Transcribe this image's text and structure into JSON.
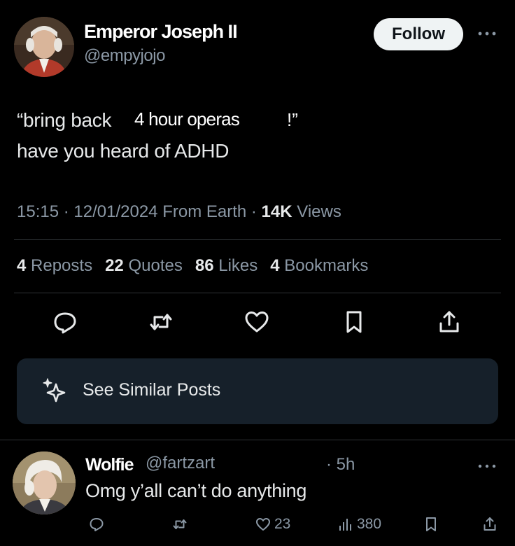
{
  "post": {
    "author_name": "Emperor Joseph II",
    "author_handle": "@empyjojo",
    "follow_label": "Follow",
    "text_line1_start": "“bring back",
    "text_insert": "4 hour operas",
    "text_line1_end": "!”",
    "text_line2": "have you heard of ADHD",
    "time": "15:15",
    "date": "12/01/2024",
    "source": "From Earth",
    "views_count": "14K",
    "views_label": "Views",
    "reposts_count": "4",
    "reposts_label": "Reposts",
    "quotes_count": "22",
    "quotes_label": "Quotes",
    "likes_count": "86",
    "likes_label": "Likes",
    "bookmarks_count": "4",
    "bookmarks_label": "Bookmarks",
    "similar_label": "See Similar Posts"
  },
  "reply": {
    "author_name": "Wolfie",
    "author_handle": "@fartzart",
    "time": "5h",
    "text": "Omg y’all can’t do anything",
    "likes": "23",
    "views": "380"
  },
  "icons": [
    "reply-icon",
    "repost-icon",
    "like-icon",
    "bookmark-icon",
    "share-icon",
    "sparkle-icon",
    "more-icon",
    "views-icon"
  ],
  "colors": {
    "background": "#000000",
    "text_primary": "#e7e9ea",
    "text_secondary": "#8b98a5",
    "follow_bg": "#eff3f4",
    "card_bg": "#16202a",
    "divider": "#2f3336"
  }
}
